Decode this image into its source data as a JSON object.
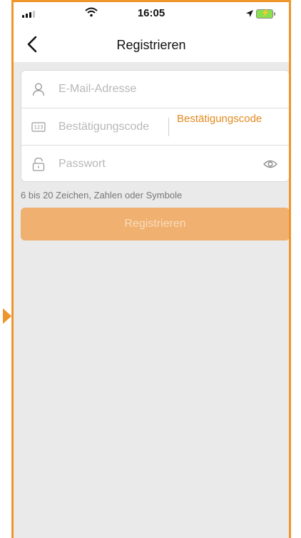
{
  "status_bar": {
    "time": "16:05",
    "icons": [
      "cellular-signal-icon",
      "wifi-icon",
      "location-arrow-icon",
      "battery-charging-icon"
    ]
  },
  "nav": {
    "title": "Registrieren",
    "back_icon": "chevron-left-icon"
  },
  "form": {
    "email": {
      "placeholder": "E-Mail-Adresse",
      "value": "",
      "icon": "user-icon"
    },
    "code": {
      "placeholder": "Bestätigungscode",
      "value": "",
      "icon": "number-keypad-icon",
      "button_label": "Bestätigungscode"
    },
    "password": {
      "placeholder": "Passwort",
      "value": "",
      "icon": "lock-icon",
      "toggle_icon": "eye-icon"
    }
  },
  "hint": "6 bis 20 Zeichen, Zahlen oder Symbole",
  "register_button": {
    "label": "Registrieren"
  },
  "colors": {
    "accent": "#e38a1f",
    "button_disabled": "#f0b06f",
    "page_background": "#eaeaea",
    "frame": "#f0952b"
  }
}
